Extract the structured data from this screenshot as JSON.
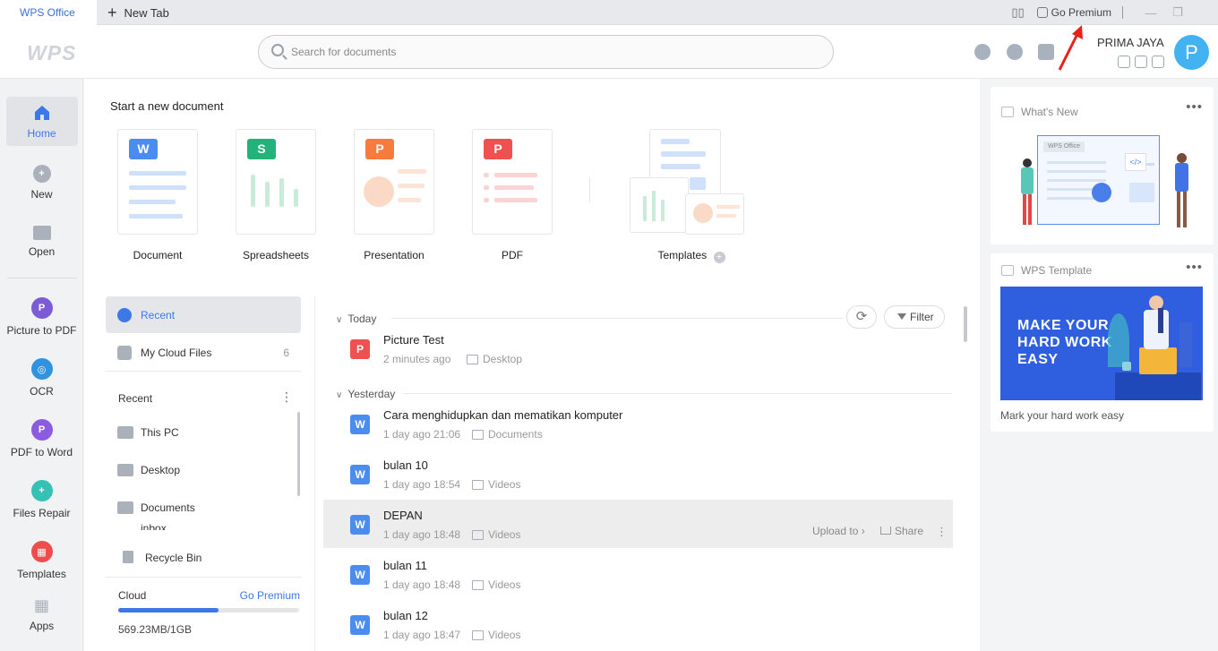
{
  "titlebar": {
    "tabs": [
      {
        "label": "WPS Office"
      },
      {
        "label": "New Tab"
      }
    ],
    "go_premium": "Go Premium"
  },
  "header": {
    "logo": "WPS",
    "search_placeholder": "Search for documents",
    "user_name": "PRIMA JAYA",
    "avatar_initial": "P"
  },
  "leftnav": {
    "items": [
      {
        "label": "Home",
        "icon": "home-icon",
        "color": "#3c78e8"
      },
      {
        "label": "New",
        "icon": "plus-circle-icon",
        "color": "#aab1bb"
      },
      {
        "label": "Open",
        "icon": "folder-icon",
        "color": "#aab1bb"
      },
      {
        "label": "Picture to PDF",
        "icon": "picture-to-pdf-icon",
        "color": "#7b5cd6"
      },
      {
        "label": "OCR",
        "icon": "ocr-icon",
        "color": "#2f93e0"
      },
      {
        "label": "PDF to Word",
        "icon": "pdf-to-word-icon",
        "color": "#8c5ce0"
      },
      {
        "label": "Files Repair",
        "icon": "files-repair-icon",
        "color": "#35c2b4"
      },
      {
        "label": "Templates",
        "icon": "templates-icon",
        "color": "#ef4d4d"
      },
      {
        "label": "Apps",
        "icon": "apps-icon",
        "color": "#aab1bb"
      }
    ]
  },
  "start": {
    "title": "Start a new document",
    "cards": [
      {
        "label": "Document",
        "badge": "W",
        "color": "#4a8cf0"
      },
      {
        "label": "Spreadsheets",
        "badge": "S",
        "color": "#23b27a"
      },
      {
        "label": "Presentation",
        "badge": "P",
        "color": "#f57c3c"
      },
      {
        "label": "PDF",
        "badge": "P",
        "color": "#ef5050"
      },
      {
        "label": "Templates",
        "badge": "",
        "color": "#4a8cf0"
      }
    ]
  },
  "filepanel": {
    "recent": "Recent",
    "cloud_files": "My Cloud Files",
    "cloud_files_count": "6",
    "recent_section": "Recent",
    "places": [
      "This PC",
      "Desktop",
      "Documents",
      "inbox"
    ],
    "recycle_bin": "Recycle Bin",
    "cloud_label": "Cloud",
    "go_premium": "Go Premium",
    "storage": "569.23MB/1GB",
    "storage_used_fraction": 0.556
  },
  "filelist": {
    "groups": [
      "Today",
      "Yesterday"
    ],
    "refresh_label": "⟳",
    "filter_label": "Filter",
    "rows": [
      {
        "name": "Picture Test",
        "time": "2 minutes ago",
        "location": "Desktop",
        "type": "pdf",
        "badge": "P"
      },
      {
        "name": "Cara menghidupkan dan mematikan komputer",
        "time": "1 day ago 21:06",
        "location": "Documents",
        "type": "word",
        "badge": "W"
      },
      {
        "name": "bulan 10",
        "time": "1 day ago 18:54",
        "location": "Videos",
        "type": "word",
        "badge": "W"
      },
      {
        "name": "DEPAN",
        "time": "1 day ago 18:48",
        "location": "Videos",
        "type": "word",
        "badge": "W"
      },
      {
        "name": "bulan 11",
        "time": "1 day ago 18:48",
        "location": "Videos",
        "type": "word",
        "badge": "W"
      },
      {
        "name": "bulan 12",
        "time": "1 day ago 18:47",
        "location": "Videos",
        "type": "word",
        "badge": "W"
      }
    ],
    "upload_to": "Upload to",
    "share": "Share"
  },
  "right": {
    "whats_new": "What's New",
    "wps_office_label": "WPS Office",
    "template_title": "WPS Template",
    "banner_text": [
      "MAKE YOUR",
      "HARD WORK",
      "EASY"
    ],
    "caption": "Mark your hard work easy"
  },
  "colors": {
    "accent": "#3c78e8",
    "word": "#4a8cf0",
    "pdf": "#ef5050",
    "arrow": "#e8221b"
  }
}
